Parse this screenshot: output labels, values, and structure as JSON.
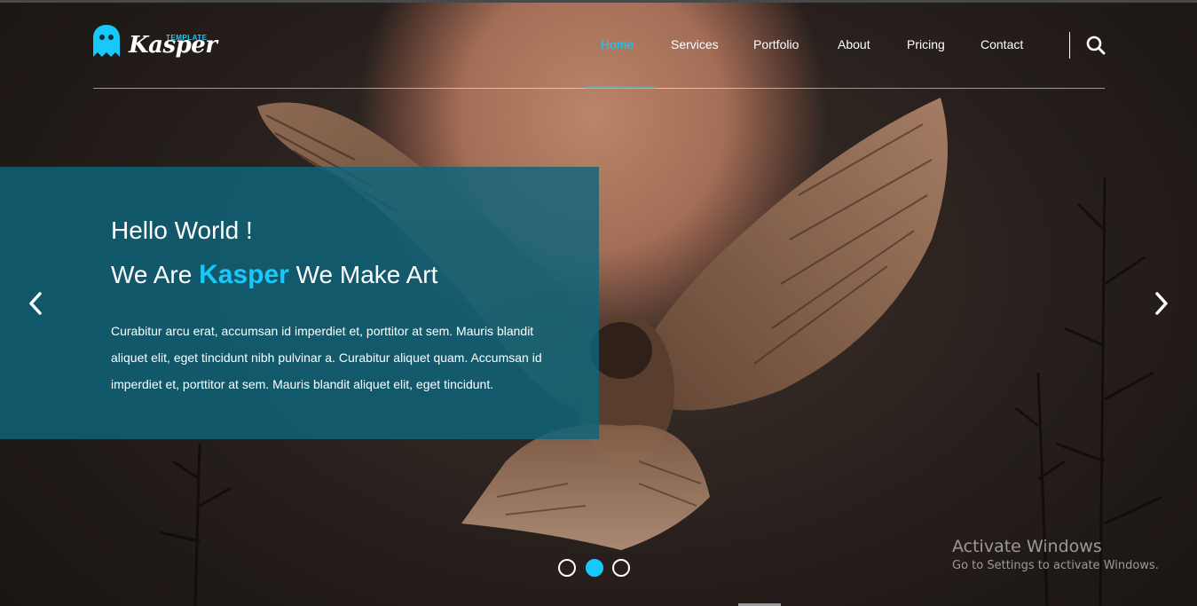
{
  "logo": {
    "small_text": "TEMPLATE",
    "word": "Kasper",
    "accent_color": "#19c8fa"
  },
  "nav": {
    "items": [
      {
        "label": "Home",
        "active": true
      },
      {
        "label": "Services",
        "active": false
      },
      {
        "label": "Portfolio",
        "active": false
      },
      {
        "label": "About",
        "active": false
      },
      {
        "label": "Pricing",
        "active": false
      },
      {
        "label": "Contact",
        "active": false
      }
    ],
    "search_icon": "search-icon"
  },
  "hero": {
    "greeting": "Hello World !",
    "headline_before": "We Are ",
    "headline_brand": "Kasper",
    "headline_after": " We Make Art",
    "paragraph": "Curabitur arcu erat, accumsan id imperdiet et, porttitor at sem. Mauris blandit aliquet elit, eget tincidunt nibh pulvinar a. Curabitur aliquet quam. Accumsan id imperdiet et, porttitor at sem. Mauris blandit aliquet elit, eget tincidunt.",
    "prev_icon": "chevron-left-icon",
    "next_icon": "chevron-right-icon"
  },
  "slider": {
    "total_slides": 3,
    "active_index": 1
  },
  "watermark": {
    "title": "Activate Windows",
    "subtitle": "Go to Settings to activate Windows."
  }
}
